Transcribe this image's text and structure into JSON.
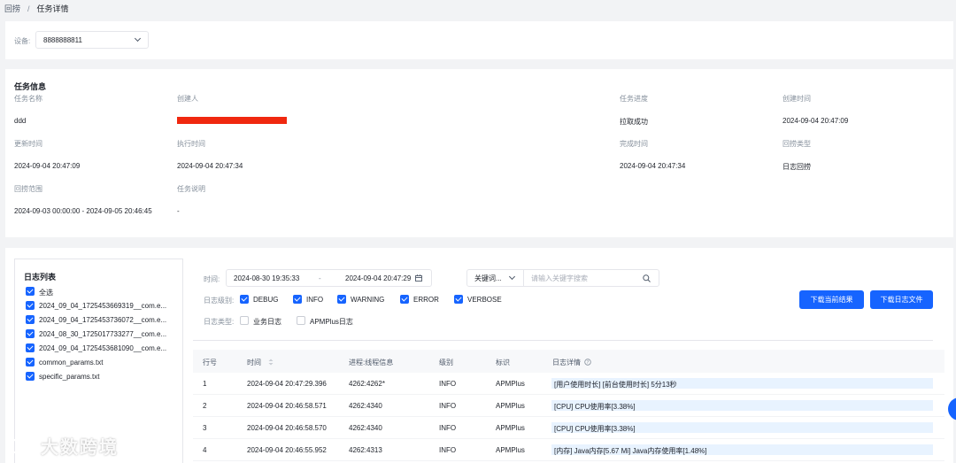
{
  "breadcrumb": {
    "parent": "回捞",
    "separator": "/",
    "current": "任务详情"
  },
  "device": {
    "label": "设备:",
    "value": "8888888811"
  },
  "task_info": {
    "title": "任务信息",
    "fields": {
      "task_name": {
        "label": "任务名称",
        "value": "ddd"
      },
      "creator": {
        "label": "创建人",
        "value": ""
      },
      "progress": {
        "label": "任务进度",
        "value": "拉取成功"
      },
      "create_time": {
        "label": "创建时间",
        "value": "2024-09-04 20:47:09"
      },
      "update_time": {
        "label": "更新时间",
        "value": "2024-09-04 20:47:09"
      },
      "exec_time": {
        "label": "执行时间",
        "value": "2024-09-04 20:47:34"
      },
      "finish_time": {
        "label": "完成时间",
        "value": "2024-09-04 20:47:34"
      },
      "fetch_type": {
        "label": "回捞类型",
        "value": "日志回捞"
      },
      "fetch_range": {
        "label": "回捞范围",
        "value": "2024-09-03 00:00:00 - 2024-09-05 20:46:45"
      },
      "description": {
        "label": "任务说明",
        "value": "-"
      }
    }
  },
  "log_list": {
    "title": "日志列表",
    "items": [
      {
        "label": "全选",
        "checked": true
      },
      {
        "label": "2024_09_04_1725453669319__com.e...",
        "checked": true
      },
      {
        "label": "2024_09_04_1725453736072__com.e...",
        "checked": true
      },
      {
        "label": "2024_08_30_1725017733277__com.e...",
        "checked": true
      },
      {
        "label": "2024_09_04_1725453681090__com.e...",
        "checked": true
      },
      {
        "label": "common_params.txt",
        "checked": true
      },
      {
        "label": "specific_params.txt",
        "checked": true
      }
    ]
  },
  "filters": {
    "time_label": "时间:",
    "start_time": "2024-08-30 19:35:33",
    "range_sep": "-",
    "end_time": "2024-09-04 20:47:29",
    "keyword_select": "关键词...",
    "search_placeholder": "请输入关键字搜索",
    "level_label": "日志级别:",
    "levels": [
      {
        "label": "DEBUG",
        "checked": true
      },
      {
        "label": "INFO",
        "checked": true
      },
      {
        "label": "WARNING",
        "checked": true
      },
      {
        "label": "ERROR",
        "checked": true
      },
      {
        "label": "VERBOSE",
        "checked": true
      }
    ],
    "type_label": "日志类型:",
    "types": [
      {
        "label": "业务日志",
        "checked": false
      },
      {
        "label": "APMPlus日志",
        "checked": false
      }
    ]
  },
  "buttons": {
    "download_current": "下载当前结果",
    "download_file": "下载日志文件"
  },
  "table": {
    "headers": [
      "行号",
      "时间",
      "进程:线程信息",
      "级别",
      "标识",
      "日志详情"
    ],
    "rows": [
      [
        "1",
        "2024-09-04 20:47:29.396",
        "4262:4262*",
        "INFO",
        "APMPlus",
        "[用户使用时长] [前台使用时长] 5分13秒"
      ],
      [
        "2",
        "2024-09-04 20:46:58.571",
        "4262:4340",
        "INFO",
        "APMPlus",
        "[CPU] CPU使用率[3.38%]"
      ],
      [
        "3",
        "2024-09-04 20:46:58.570",
        "4262:4340",
        "INFO",
        "APMPlus",
        "[CPU] CPU使用率[3.38%]"
      ],
      [
        "4",
        "2024-09-04 20:46:55.952",
        "4262:4313",
        "INFO",
        "APMPlus",
        "[内存] Java内存[5.67 Mi] Java内存使用率[1.48%]"
      ]
    ]
  },
  "watermark": "大数跨境",
  "colors": {
    "primary": "#1664ff",
    "redact": "#f0280f",
    "background": "#f2f3f5"
  }
}
